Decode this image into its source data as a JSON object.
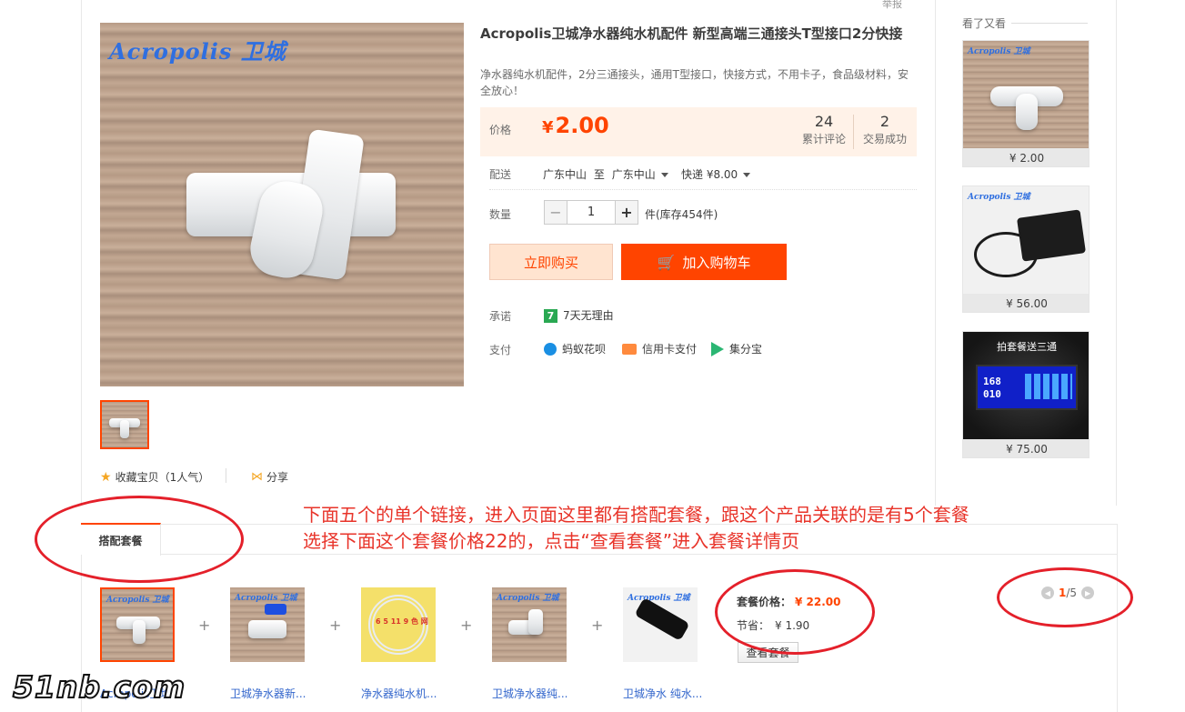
{
  "header": {
    "report_link": "举报"
  },
  "product": {
    "brand_logo": "Acropolis 卫城",
    "title": "Acropolis卫城净水器纯水机配件 新型高端三通接头T型接口2分快接",
    "subtitle": "净水器纯水机配件，2分三通接头，通用T型接口，快接方式，不用卡子，食品级材料，安全放心！",
    "price_label": "价格",
    "price_currency": "¥",
    "price": "2.00",
    "reviews_count": "24",
    "reviews_label": "累计评论",
    "trades_count": "2",
    "trades_label": "交易成功",
    "shipping_label": "配送",
    "shipping_from": "广东中山",
    "shipping_to_word": "至",
    "shipping_to": "广东中山",
    "shipping_method": "快递 ¥8.00",
    "qty_label": "数量",
    "qty_minus": "−",
    "qty_value": "1",
    "qty_plus": "+",
    "stock_text": "件(库存454件)",
    "buy_now": "立即购买",
    "add_cart": "加入购物车",
    "promise_label": "承诺",
    "promise_badge": "7",
    "promise_text": "7天无理由",
    "pay_label": "支付",
    "pay_methods": [
      "蚂蚁花呗",
      "信用卡支付",
      "集分宝"
    ],
    "favorite_text": "收藏宝贝（1人气）",
    "share_text": "分享"
  },
  "sidebar": {
    "title": "看了又看",
    "items": [
      {
        "price": "¥ 2.00"
      },
      {
        "price": "¥ 56.00"
      },
      {
        "price": "¥ 75.00",
        "banner": "拍套餐送三通",
        "display": "168 010"
      }
    ]
  },
  "combo": {
    "tab_label": "搭配套餐",
    "items": [
      {
        "name": "Acropolis卫城"
      },
      {
        "name": "卫城净水器新..."
      },
      {
        "name": "净水器纯水机..."
      },
      {
        "name": "卫城净水器纯..."
      },
      {
        "name": "卫城净水 纯水..."
      }
    ],
    "plus": "+",
    "price_label": "套餐价格：",
    "price_value": "¥ 22.00",
    "save_label": "节省：",
    "save_value": "¥ 1.90",
    "view_button": "查看套餐",
    "pager_current": "1",
    "pager_total": "/5",
    "pager_prev": "◀",
    "pager_next": "▶",
    "coil_label": "6 5 11 9 色 网"
  },
  "annotation": {
    "line1": "下面五个的单个链接，进入页面这里都有搭配套餐，跟这个产品关联的是有5个套餐",
    "line2": "选择下面这个套餐价格22的，点击“查看套餐”进入套餐详情页"
  },
  "watermark": "51nb.com",
  "colors": {
    "accent": "#ff4400",
    "annotation": "#e4202a",
    "link": "#3366cc"
  }
}
